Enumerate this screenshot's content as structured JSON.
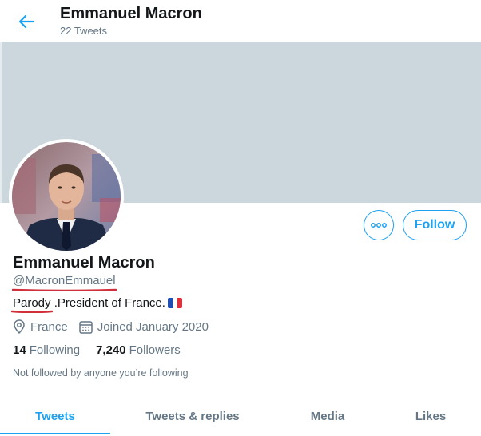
{
  "header": {
    "title": "Emmanuel Macron",
    "tweet_count": "22 Tweets"
  },
  "profile": {
    "name": "Emmanuel Macron",
    "handle": "@MacronEmmauel",
    "bio_parody": "Parody",
    "bio_rest": " .President of France.",
    "location": "France",
    "joined": "Joined January 2020",
    "following_count": "14",
    "following_label": "Following",
    "followers_count": "7,240",
    "followers_label": "Followers",
    "not_followed": "Not followed by anyone you’re following"
  },
  "actions": {
    "follow_label": "Follow",
    "more_icon": "more-icon"
  },
  "tabs": [
    {
      "label": "Tweets",
      "active": true
    },
    {
      "label": "Tweets & replies",
      "active": false
    },
    {
      "label": "Media",
      "active": false
    },
    {
      "label": "Likes",
      "active": false
    }
  ],
  "colors": {
    "accent": "#1da1f2",
    "banner": "#ccd6dd",
    "annotation_red": "#d0303a",
    "secondary_text": "#657786"
  }
}
